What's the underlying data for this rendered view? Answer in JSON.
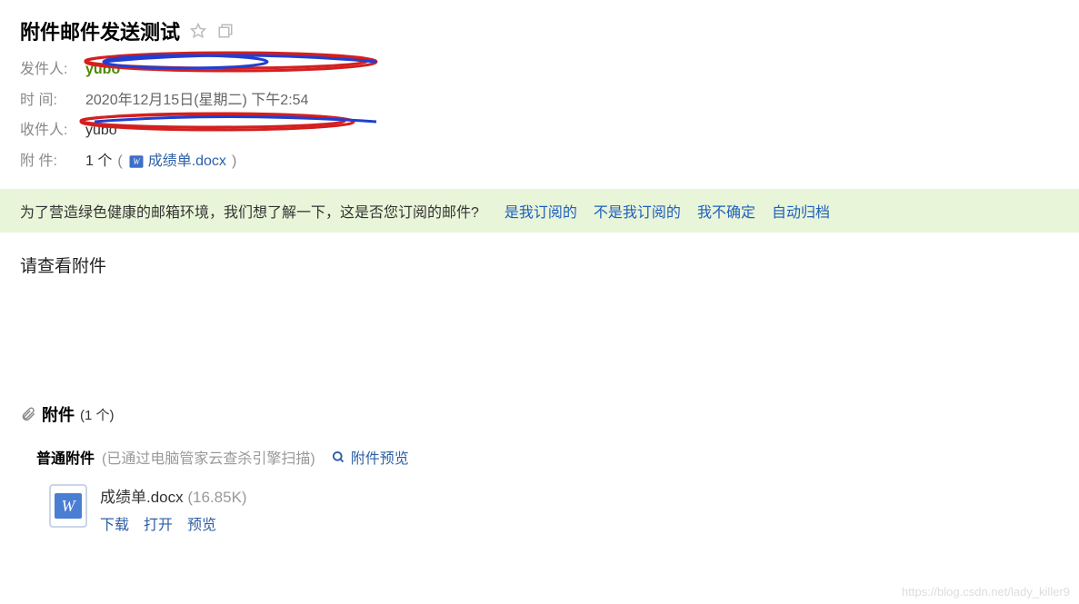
{
  "header": {
    "title": "附件邮件发送测试"
  },
  "meta": {
    "sender_label": "发件人:",
    "sender_name": "yubo",
    "time_label": "时   间:",
    "time_value": "2020年12月15日(星期二) 下午2:54",
    "recipient_label": "收件人:",
    "recipient_name": "yubo",
    "attach_label": "附   件:",
    "attach_count": "1 个",
    "attach_paren_open": "(",
    "attach_filename": "成绩单.docx",
    "attach_paren_close": ")"
  },
  "prompt": {
    "text": "为了营造绿色健康的邮箱环境，我们想了解一下，这是否您订阅的邮件?",
    "yes": "是我订阅的",
    "no": "不是我订阅的",
    "unsure": "我不确定",
    "archive": "自动归档"
  },
  "body": {
    "content": "请查看附件"
  },
  "attachments": {
    "section_title": "附件",
    "section_count": "(1 个)",
    "subtitle": "普通附件",
    "scan_note": "(已通过电脑管家云查杀引擎扫描)",
    "preview_link": "附件预览",
    "item": {
      "name": "成绩单.docx",
      "size": "(16.85K)",
      "download": "下载",
      "open": "打开",
      "preview": "预览"
    }
  },
  "watermark": "https://blog.csdn.net/lady_killer9"
}
